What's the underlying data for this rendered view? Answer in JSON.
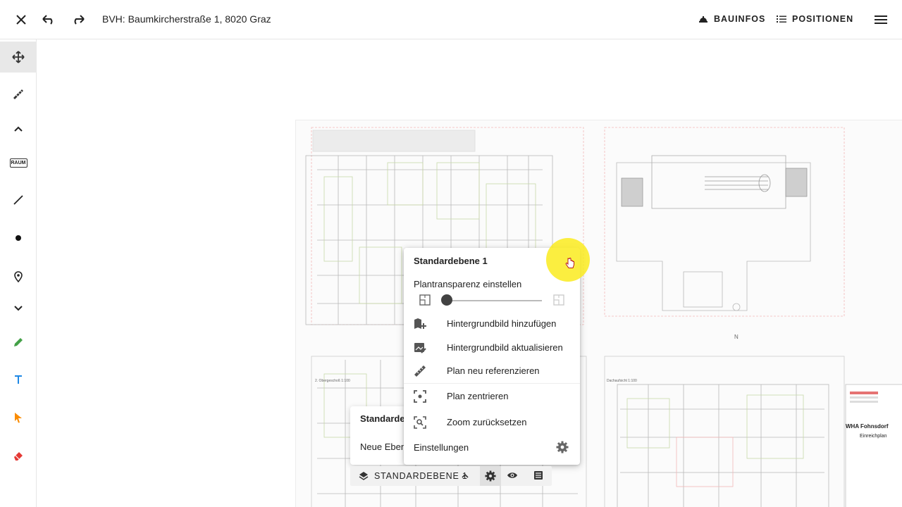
{
  "header": {
    "title": "BVH: Baumkircherstraße 1, 8020 Graz",
    "nav_bauinfos": "BAUINFOS",
    "nav_positionen": "POSITIONEN"
  },
  "toolbar": {
    "raum_label": "RAUM"
  },
  "colors": {
    "accent_green": "#43a047",
    "text_tool_blue": "#1e88e5",
    "select_orange": "#fb8c00",
    "eraser_red": "#e53935",
    "cursor_highlight": "#f5e61e"
  },
  "plan": {
    "label_tl": "2. Obergeschoß    1:100",
    "label_tr": "Dachaufsicht    1:100",
    "north": "N",
    "stamp_company": "WHA Fohnsdorf",
    "stamp_type": "Einreichplan"
  },
  "menu": {
    "title": "Standardebene 1",
    "transparency_label": "Plantransparenz einstellen",
    "transparency_value": 0.05,
    "items": [
      {
        "label": "Hintergrundbild hinzufügen",
        "icon": "map-add-icon"
      },
      {
        "label": "Hintergrundbild aktualisieren",
        "icon": "image-edit-icon"
      },
      {
        "label": "Plan neu referenzieren",
        "icon": "ruler-icon"
      },
      {
        "label": "Plan zentrieren",
        "icon": "center-focus-icon"
      },
      {
        "label": "Zoom zurücksetzen",
        "icon": "zoom-reset-icon"
      }
    ],
    "settings_label": "Einstellungen"
  },
  "layer_panel": {
    "title": "Standarde",
    "new_layer": "Neue Eben"
  },
  "layer_bar": {
    "label": "STANDARDEBENE 1"
  }
}
